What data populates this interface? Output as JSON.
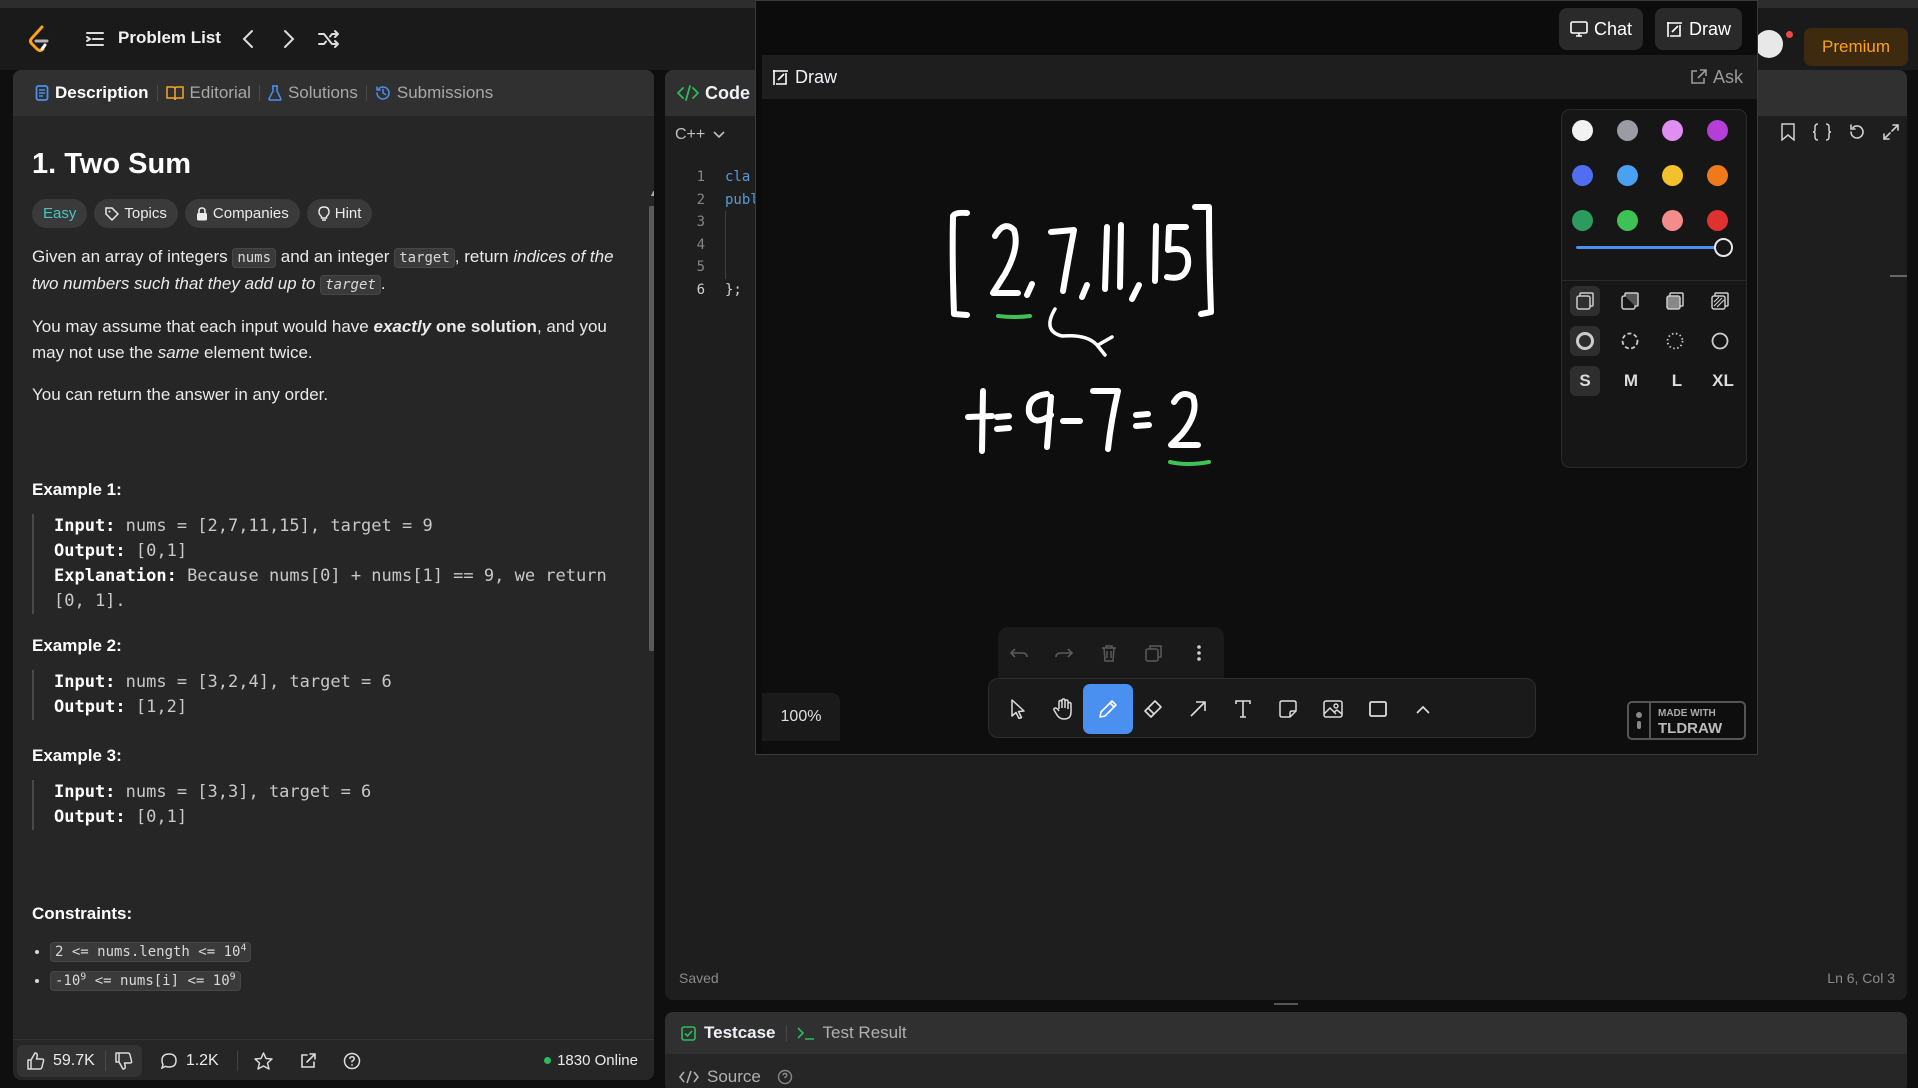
{
  "nav": {
    "problem_list": "Problem List",
    "premium": "Premium"
  },
  "overlay_top": {
    "chat": "Chat",
    "draw": "Draw"
  },
  "left_tabs": [
    {
      "label": "Description"
    },
    {
      "label": "Editorial"
    },
    {
      "label": "Solutions"
    },
    {
      "label": "Submissions"
    }
  ],
  "problem": {
    "title": "1. Two Sum",
    "tags": {
      "difficulty": "Easy",
      "topics": "Topics",
      "companies": "Companies",
      "hint": "Hint"
    },
    "p1": {
      "t1": "Given an array of integers ",
      "c1": "nums",
      "t2": " and an integer ",
      "c2": "target",
      "t3": ", return ",
      "i1": "indices of the two numbers such that they add up to ",
      "c3": "target",
      "t4": "."
    },
    "p2": {
      "t1": "You may assume that each input would have ",
      "b1": "exactly",
      "b2": " one solution",
      "t2": ", and you may not use the ",
      "i1": "same",
      "t3": " element twice."
    },
    "p3": "You can return the answer in any order.",
    "examples": [
      {
        "heading": "Example 1:",
        "input_label": "Input:",
        "input": " nums = [2,7,11,15], target = 9",
        "output_label": "Output:",
        "output": " [0,1]",
        "expl_label": "Explanation:",
        "expl": " Because nums[0] + nums[1] == 9, we return [0, 1]."
      },
      {
        "heading": "Example 2:",
        "input_label": "Input:",
        "input": " nums = [3,2,4], target = 6",
        "output_label": "Output:",
        "output": " [1,2]"
      },
      {
        "heading": "Example 3:",
        "input_label": "Input:",
        "input": " nums = [3,3], target = 6",
        "output_label": "Output:",
        "output": " [0,1]"
      }
    ],
    "constraints_heading": "Constraints:",
    "constraints": [
      {
        "a": "2 <= nums.length <= 10",
        "sup": "4"
      },
      {
        "a": "-10",
        "sup": "9",
        "b": " <= nums[i] <= 10",
        "sup2": "9"
      }
    ]
  },
  "left_footer": {
    "likes": "59.7K",
    "comments": "1.2K",
    "online": "1830 Online"
  },
  "code": {
    "tab": "Code",
    "language": "C++",
    "line_numbers": [
      "1",
      "2",
      "3",
      "4",
      "5",
      "6"
    ],
    "lines": [
      "cla",
      "publ",
      "",
      "",
      "",
      "};"
    ],
    "status": "Saved",
    "cursor": "Ln 6, Col 3"
  },
  "test": {
    "testcase": "Testcase",
    "test_result": "Test Result",
    "source": "Source"
  },
  "draw": {
    "title": "Draw",
    "ask": "Ask",
    "zoom": "100%",
    "watermark_line1": "MADE WITH",
    "watermark_line2": "TLDRAW",
    "sizes": [
      "S",
      "M",
      "L",
      "XL"
    ],
    "colors": [
      "#f2f2f2",
      "#9b9ba5",
      "#e08ef2",
      "#b53ed8",
      "#4f6ff0",
      "#4ba1f1",
      "#f2c12d",
      "#ef7a1c",
      "#2b9b5e",
      "#3fc255",
      "#f48c8c",
      "#e03131"
    ],
    "selected_tool": "draw",
    "accent": "#4a90f0",
    "drawn_text": {
      "array": "[2, 7, 11, 15]",
      "equation": "t = 9 - 7 = 2"
    }
  }
}
